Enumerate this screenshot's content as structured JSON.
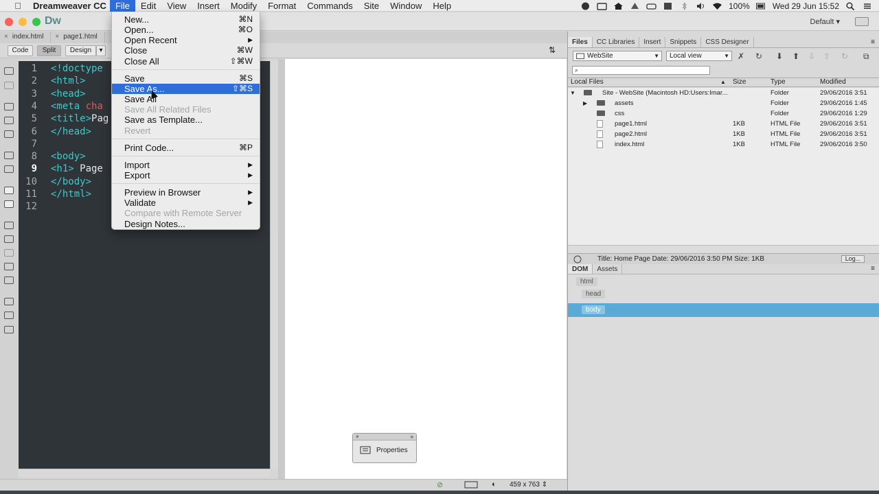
{
  "menubar": {
    "app_name": "Dreamweaver CC",
    "items": [
      "File",
      "Edit",
      "View",
      "Insert",
      "Modify",
      "Format",
      "Commands",
      "Site",
      "Window",
      "Help"
    ],
    "active": "File",
    "battery": "100%",
    "datetime": "Wed 29 Jun  15:52"
  },
  "titlebar": {
    "logo": "Dw",
    "workspace": "Default"
  },
  "doc_tabs": [
    "index.html",
    "page1.html"
  ],
  "view_buttons": {
    "code": "Code",
    "split": "Split",
    "design": "Design"
  },
  "code": {
    "current_line": 9,
    "lines": [
      {
        "n": "1",
        "t": "<!doctype",
        "w": "",
        "r": ""
      },
      {
        "n": "2",
        "t": "<html>",
        "w": "",
        "r": ""
      },
      {
        "n": "3",
        "t": "<head>",
        "w": "",
        "r": ""
      },
      {
        "n": "4",
        "t": "<meta ",
        "w": "",
        "r": "cha"
      },
      {
        "n": "5",
        "t": "<title>",
        "w": "Pag",
        "r": ""
      },
      {
        "n": "6",
        "t": "</head>",
        "w": "",
        "r": ""
      },
      {
        "n": "7",
        "t": "",
        "w": "",
        "r": ""
      },
      {
        "n": "8",
        "t": "<body>",
        "w": "",
        "r": ""
      },
      {
        "n": "9",
        "t": "<h1>",
        "w": " Page",
        "r": ""
      },
      {
        "n": "10",
        "t": "</body>",
        "w": "",
        "r": ""
      },
      {
        "n": "11",
        "t": "</html>",
        "w": "",
        "r": ""
      },
      {
        "n": "12",
        "t": "",
        "w": "",
        "r": ""
      }
    ]
  },
  "file_menu": {
    "items": [
      {
        "label": "New...",
        "shortcut": "⌘N",
        "disabled": false,
        "submenu": false,
        "highlighted": false
      },
      {
        "label": "Open...",
        "shortcut": "⌘O",
        "disabled": false,
        "submenu": false,
        "highlighted": false
      },
      {
        "label": "Open Recent",
        "shortcut": "",
        "disabled": false,
        "submenu": true,
        "highlighted": false
      },
      {
        "label": "Close",
        "shortcut": "⌘W",
        "disabled": false,
        "submenu": false,
        "highlighted": false
      },
      {
        "label": "Close All",
        "shortcut": "⇧⌘W",
        "disabled": false,
        "submenu": false,
        "highlighted": false
      },
      {
        "sep": true
      },
      {
        "label": "Save",
        "shortcut": "⌘S",
        "disabled": false,
        "submenu": false,
        "highlighted": false
      },
      {
        "label": "Save As...",
        "shortcut": "⇧⌘S",
        "disabled": false,
        "submenu": false,
        "highlighted": true
      },
      {
        "label": "Save All",
        "shortcut": "",
        "disabled": false,
        "submenu": false,
        "highlighted": false
      },
      {
        "label": "Save All Related Files",
        "shortcut": "",
        "disabled": true,
        "submenu": false,
        "highlighted": false
      },
      {
        "label": "Save as Template...",
        "shortcut": "",
        "disabled": false,
        "submenu": false,
        "highlighted": false
      },
      {
        "label": "Revert",
        "shortcut": "",
        "disabled": true,
        "submenu": false,
        "highlighted": false
      },
      {
        "sep": true
      },
      {
        "label": "Print Code...",
        "shortcut": "⌘P",
        "disabled": false,
        "submenu": false,
        "highlighted": false
      },
      {
        "sep": true
      },
      {
        "label": "Import",
        "shortcut": "",
        "disabled": false,
        "submenu": true,
        "highlighted": false
      },
      {
        "label": "Export",
        "shortcut": "",
        "disabled": false,
        "submenu": true,
        "highlighted": false
      },
      {
        "sep": true
      },
      {
        "label": "Preview in Browser",
        "shortcut": "",
        "disabled": false,
        "submenu": true,
        "highlighted": false
      },
      {
        "label": "Validate",
        "shortcut": "",
        "disabled": false,
        "submenu": true,
        "highlighted": false
      },
      {
        "label": "Compare with Remote Server",
        "shortcut": "",
        "disabled": true,
        "submenu": false,
        "highlighted": false
      },
      {
        "label": "Design Notes...",
        "shortcut": "",
        "disabled": false,
        "submenu": false,
        "highlighted": false
      }
    ]
  },
  "properties_panel": {
    "label": "Properties"
  },
  "status_bar": {
    "size": "459 x 763"
  },
  "files_panel": {
    "tabs": [
      "Files",
      "CC Libraries",
      "Insert",
      "Snippets",
      "CSS Designer"
    ],
    "active_tab": "Files",
    "site": "WebSite",
    "view": "Local view",
    "columns": {
      "name": "Local Files",
      "size": "Size",
      "type": "Type",
      "modified": "Modified"
    },
    "rows": [
      {
        "name": "Site - WebSite (Macintosh HD:Users:Imar...",
        "size": "",
        "type": "Folder",
        "modified": "29/06/2016 3:51",
        "kind": "site"
      },
      {
        "name": "assets",
        "size": "",
        "type": "Folder",
        "modified": "29/06/2016 1:45",
        "kind": "folder"
      },
      {
        "name": "css",
        "size": "",
        "type": "Folder",
        "modified": "29/06/2016 1:29",
        "kind": "folder"
      },
      {
        "name": "page1.html",
        "size": "1KB",
        "type": "HTML File",
        "modified": "29/06/2016 3:51",
        "kind": "file"
      },
      {
        "name": "page2.html",
        "size": "1KB",
        "type": "HTML File",
        "modified": "29/06/2016 3:51",
        "kind": "file"
      },
      {
        "name": "index.html",
        "size": "1KB",
        "type": "HTML File",
        "modified": "29/06/2016 3:50",
        "kind": "file"
      }
    ],
    "info": "Title: Home Page  Date: 29/06/2016 3:50 PM  Size: 1KB",
    "log_button": "Log..."
  },
  "dom_panel": {
    "tabs": [
      "DOM",
      "Assets"
    ],
    "active_tab": "DOM",
    "nodes": [
      "html",
      "head",
      "body"
    ],
    "selected": "body"
  }
}
